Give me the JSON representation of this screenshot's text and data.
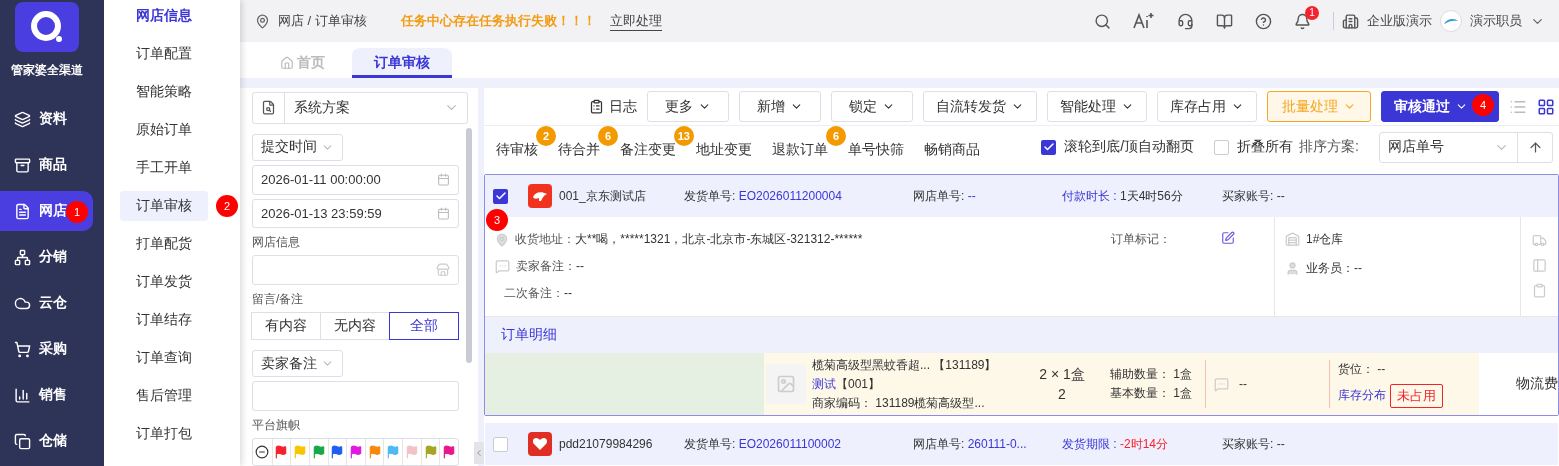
{
  "sidebar": {
    "logo_text": "管家婆全渠道",
    "items": [
      {
        "label": "资料",
        "selected": false
      },
      {
        "label": "商品",
        "selected": false
      },
      {
        "label": "网店",
        "selected": true,
        "step": "1"
      },
      {
        "label": "分销",
        "selected": false
      },
      {
        "label": "云仓",
        "selected": false
      },
      {
        "label": "采购",
        "selected": false
      },
      {
        "label": "销售",
        "selected": false
      },
      {
        "label": "仓储",
        "selected": false
      }
    ]
  },
  "submenu": {
    "heading": "网店信息",
    "items": [
      {
        "label": "订单配置",
        "selected": false
      },
      {
        "label": "智能策略",
        "selected": false
      },
      {
        "label": "原始订单",
        "selected": false
      },
      {
        "label": "手工开单",
        "selected": false
      },
      {
        "label": "订单审核",
        "selected": true,
        "step": "2"
      },
      {
        "label": "打单配货",
        "selected": false
      },
      {
        "label": "订单发货",
        "selected": false
      },
      {
        "label": "订单结存",
        "selected": false
      },
      {
        "label": "订单查询",
        "selected": false
      },
      {
        "label": "售后管理",
        "selected": false
      },
      {
        "label": "订单打包",
        "selected": false
      }
    ]
  },
  "header": {
    "breadcrumb": "网店 / 订单审核",
    "alert": "任务中心存在任务执行失败！！！",
    "alert_action": "立即处理",
    "notifications": "1",
    "edition": "企业版演示",
    "user": "演示职员"
  },
  "tabs": [
    {
      "label": "首页",
      "selected": false
    },
    {
      "label": "订单审核",
      "selected": true
    }
  ],
  "filters": {
    "scheme": "系统方案",
    "time_type": "提交时间",
    "start": "2026-01-11 00:00:00",
    "end": "2026-01-13 23:59:59",
    "shop_label": "网店信息",
    "note_label": "留言/备注",
    "note_options": [
      {
        "label": "有内容",
        "selected": false
      },
      {
        "label": "无内容",
        "selected": false
      },
      {
        "label": "全部",
        "selected": true
      }
    ],
    "remark_type": "卖家备注",
    "flag_label": "平台旗帜",
    "flags": [
      {
        "color": "#f5222d"
      },
      {
        "color": "#f7c600"
      },
      {
        "color": "#18a84b"
      },
      {
        "color": "#1f5ef5"
      },
      {
        "color": "#e018e0"
      },
      {
        "color": "#f6890b"
      },
      {
        "color": "#4fb8f5"
      },
      {
        "color": "#f1c3c6"
      },
      {
        "color": "#a6a620"
      },
      {
        "color": "#e8178a"
      }
    ]
  },
  "toolbar": {
    "log": "日志",
    "buttons": [
      {
        "label": "更多",
        "kind": "default"
      },
      {
        "label": "新增",
        "kind": "default"
      },
      {
        "label": "锁定",
        "kind": "default"
      },
      {
        "label": "自流转发货",
        "kind": "default"
      },
      {
        "label": "智能处理",
        "kind": "default"
      },
      {
        "label": "库存占用",
        "kind": "default"
      },
      {
        "label": "批量处理",
        "kind": "warning"
      },
      {
        "label": "审核通过",
        "kind": "primary",
        "step": "4"
      }
    ]
  },
  "status_tabs": [
    {
      "label": "待审核",
      "count": "2"
    },
    {
      "label": "待合并",
      "count": "6"
    },
    {
      "label": "备注变更",
      "count": "13"
    },
    {
      "label": "地址变更"
    },
    {
      "label": "退款订单",
      "count": "6"
    },
    {
      "label": "单号快筛"
    },
    {
      "label": "畅销商品"
    }
  ],
  "options": {
    "auto_page": {
      "label": "滚轮到底/顶自动翻页",
      "checked": true
    },
    "collapse": {
      "label": "折叠所有",
      "checked": false
    },
    "sort_label": "排序方案:",
    "sort_value": "网店单号"
  },
  "orders": [
    {
      "checked": true,
      "kind": "jd",
      "shop": "001_京东测试店",
      "ship_label": "发货单号:",
      "ship_no": "EO2026011200004",
      "shop_no_label": "网店单号:",
      "shop_no": "--",
      "time_label": "付款时长 :",
      "time": "1天4时56分",
      "time_overdue": false,
      "buyer": "买家账号: --",
      "details": {
        "step": "3",
        "address_label": "收货地址：",
        "address": "大**喝，*****1321，北京-北京市-东城区-321312-******",
        "seller_note_label": "卖家备注：",
        "seller_note": "--",
        "second_note_label": "二次备注：",
        "second_note": "--",
        "mark_label": "订单标记：",
        "warehouse": "1#仓库",
        "salesman": "业务员：--",
        "detail_title": "订单明细",
        "item": {
          "name": "榄菊高级型黑蚊香超... 【131189】",
          "tag": "测试",
          "tag_code": "【001】",
          "code": "商家编码： 131189榄菊高级型...",
          "qty": "2 × 1盒",
          "qty_total": "2",
          "aux": "辅助数量： 1盒",
          "base": "基本数量： 1盒",
          "note": "--",
          "slot": "货位： --",
          "stock": "库存分布",
          "status": "未占用",
          "freight": "物流费"
        }
      }
    },
    {
      "checked": false,
      "kind": "pdd",
      "shop": "pdd21079984296",
      "ship_label": "发货单号:",
      "ship_no": "EO2026011100002",
      "shop_no_label": "网店单号:",
      "shop_no": "260111-0...",
      "time_label": "发货期限 :",
      "time": "-2时14分",
      "time_overdue": true,
      "buyer": "买家账号: --"
    }
  ]
}
